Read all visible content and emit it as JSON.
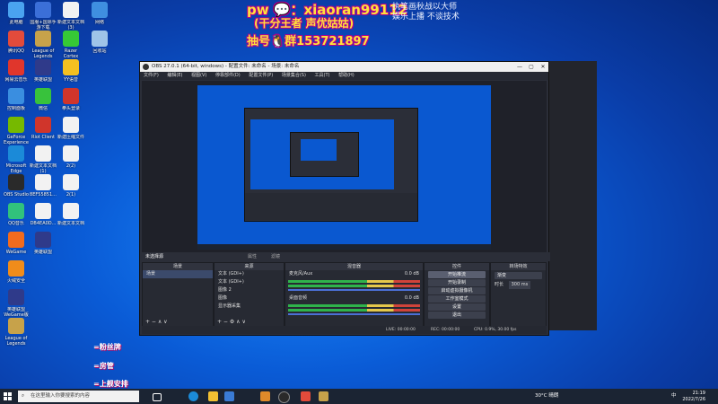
{
  "overlay": {
    "line1": "pw 💬：xiaoran99112",
    "line2": "(干分王者 声优姑姑)",
    "line3": "抽号🐧群153721897",
    "motto1": "执笔画秋战以大师",
    "motto2": "娱乐上播 不谈技术"
  },
  "desktop_icons": [
    {
      "label": "此电脑",
      "color": "#4aa3f0"
    },
    {
      "label": "国服+国际手游下载",
      "color": "#3b6fd8"
    },
    {
      "label": "新建文本文档(3)",
      "color": "#f2f2f2"
    },
    {
      "label": "网络",
      "color": "#3f8fe0"
    },
    {
      "label": "腾讯QQ",
      "color": "#e34b3b"
    },
    {
      "label": "League of Legends",
      "color": "#c7a24a"
    },
    {
      "label": "Razer Cortex",
      "color": "#36c936"
    },
    {
      "label": "回收站",
      "color": "#9fc4e8"
    },
    {
      "label": "网易云音乐",
      "color": "#e0362c"
    },
    {
      "label": "英雄联盟",
      "color": "#2f3a8a"
    },
    {
      "label": "YY语音",
      "color": "#f4c020"
    },
    {
      "label": "控制面板",
      "color": "#3a8ee0"
    },
    {
      "label": "微信",
      "color": "#38c23c"
    },
    {
      "label": "拳头登录",
      "color": "#d0352b"
    },
    {
      "label": "GeForce Experience",
      "color": "#76b900"
    },
    {
      "label": "Riot Client",
      "color": "#d0352b"
    },
    {
      "label": "新建压缩文件",
      "color": "#f2f2f2"
    },
    {
      "label": "Microsoft Edge",
      "color": "#1b8ad8"
    },
    {
      "label": "新建文本文档(1)",
      "color": "#f2f2f2"
    },
    {
      "label": "2(2)",
      "color": "#f2f2f2"
    },
    {
      "label": "OBS Studio",
      "color": "#2a2a2a"
    },
    {
      "label": "8EF55851...",
      "color": "#f2f2f2"
    },
    {
      "label": "2(1)",
      "color": "#f2f2f2"
    },
    {
      "label": "QQ音乐",
      "color": "#31c27c"
    },
    {
      "label": "DB4EA0D...",
      "color": "#f2f2f2"
    },
    {
      "label": "新建文本文档",
      "color": "#f2f2f2"
    },
    {
      "label": "WeGame",
      "color": "#f26b1d"
    },
    {
      "label": "英雄联盟",
      "color": "#2f3a8a"
    },
    {
      "label": "火绒安全",
      "color": "#f08c1a"
    },
    {
      "label": "英雄联盟WeGame版",
      "color": "#2f3a8a"
    },
    {
      "label": "League of Legends",
      "color": "#c7a24a"
    }
  ],
  "side_labels": {
    "l1": "=粉丝牌",
    "l2": "=房管",
    "l3": "=上舰安排"
  },
  "obs": {
    "title": "OBS 27.0.1 (64-bit, windows) - 配置文件: 未命名 - 场景: 未命名",
    "menu": [
      "文件(F)",
      "编辑(E)",
      "视图(V)",
      "停靠部件(D)",
      "配置文件(P)",
      "场景集合(S)",
      "工具(T)",
      "帮助(H)"
    ],
    "scene_bar": "未选择源",
    "props_label": "属性",
    "filters_label": "滤镜",
    "docks": {
      "scenes": {
        "title": "场景",
        "items": [
          "场景"
        ]
      },
      "sources": {
        "title": "来源",
        "items": [
          "文本 (GDI+)",
          "文本 (GDI+)",
          "图像 2",
          "图像",
          "显示器采集"
        ]
      },
      "mixer": {
        "title": "混音器",
        "tracks": [
          {
            "name": "麦克风/Aux",
            "db": "0.0 dB"
          },
          {
            "name": "桌面音频",
            "db": "0.0 dB"
          }
        ]
      },
      "transitions": {
        "title": "转场特效",
        "type": "渐变",
        "duration_label": "时长",
        "duration": "300 ms"
      },
      "controls": {
        "title": "控件",
        "buttons": [
          "开始推流",
          "开始录制",
          "启动虚拟摄像机",
          "工作室模式",
          "设置",
          "退出"
        ]
      }
    },
    "status": {
      "live": "LIVE: 00:00:00",
      "rec": "REC: 00:00:00",
      "cpu": "CPU: 0.9%, 30.00 fps"
    }
  },
  "taskbar": {
    "search_placeholder": "在这里输入你要搜索的内容",
    "weather": "30°C 晴朗",
    "lang": "中",
    "time": "21:19",
    "date": "2022/7/26"
  }
}
